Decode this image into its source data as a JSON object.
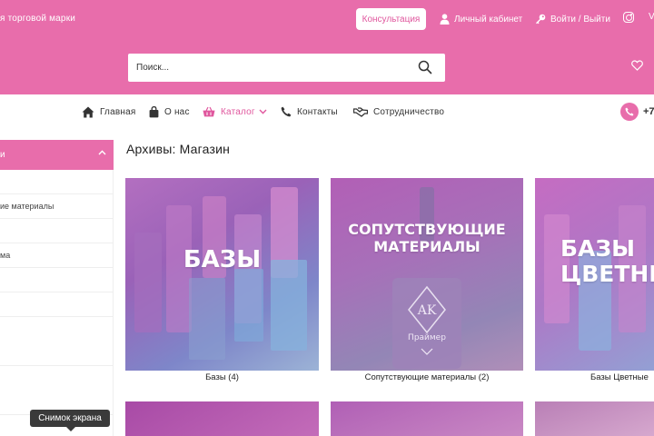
{
  "header": {
    "tagline": "я торговой марки",
    "consult_label": "Консультация",
    "account_label": "Личный кабинет",
    "login_label": "Войти / Выйти",
    "truncated_right": "V"
  },
  "search": {
    "placeholder": "Поиск..."
  },
  "nav": {
    "items": [
      {
        "label": "Главная",
        "icon": "home-icon"
      },
      {
        "label": "О нас",
        "icon": "bag-icon"
      },
      {
        "label": "Каталог",
        "icon": "basket-icon",
        "active": true
      },
      {
        "label": "Контакты",
        "icon": "phone-icon"
      },
      {
        "label": "Сотрудничество",
        "icon": "handshake-icon"
      }
    ],
    "phone_partial": "+7"
  },
  "sidebar": {
    "head_label": "и",
    "items": [
      "",
      "ие материалы",
      "",
      "ма",
      "",
      "",
      "",
      ""
    ]
  },
  "main": {
    "title": "Архивы: Магазин",
    "cards": [
      {
        "title": "БАЗЫ",
        "label": "Базы (4)"
      },
      {
        "title_line1": "СОПУТСТВУЮЩИЕ",
        "title_line2": "МАТЕРИАЛЫ",
        "label": "Сопутствующие материалы (2)"
      },
      {
        "title_line1": "БАЗЫ",
        "title_line2": "ЦВЕТНЫЕ",
        "label": "Базы Цветные"
      }
    ]
  },
  "tooltip": {
    "label": "Снимок экрана"
  },
  "colors": {
    "brand_pink": "#e86dab",
    "accent": "#e0579e"
  }
}
